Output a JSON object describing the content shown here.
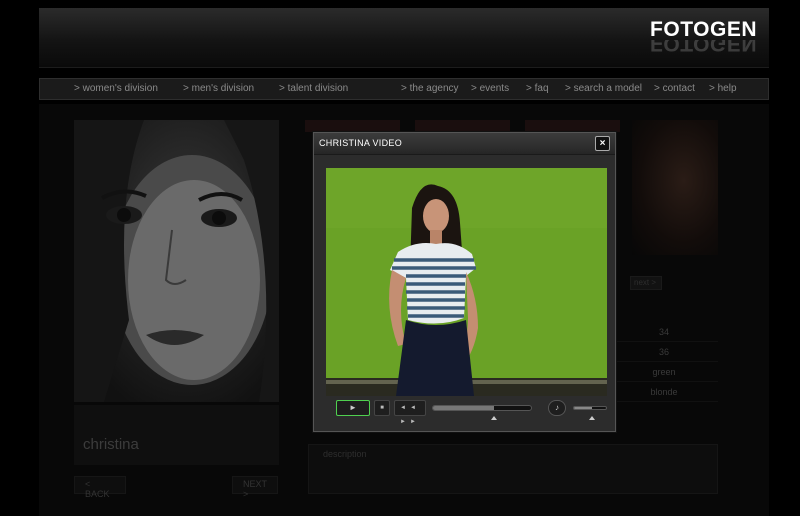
{
  "brand": {
    "logo": "FOTOGEN"
  },
  "nav": {
    "items": [
      "> women's division",
      "> men's division",
      "> talent division",
      "> the agency",
      "> events",
      "> faq",
      "> search a model",
      "> contact",
      "> help"
    ]
  },
  "background_page": {
    "model_name": "christina",
    "prev_label": "< BACK",
    "next_label": "NEXT >",
    "side_button": "next >",
    "stats": [
      "34",
      "36",
      "green",
      "blonde"
    ],
    "description_label": "description"
  },
  "modal": {
    "title": "CHRISTINA VIDEO",
    "close_label": "×",
    "player": {
      "play_icon": "►",
      "stop_icon": "■",
      "seek_icons": "◄◄ ►►",
      "volume_icon": "🔊",
      "progress": 0.62,
      "volume": 0.55
    }
  },
  "colors": {
    "green_screen": "#6aa226",
    "play_border": "#4fd04f"
  }
}
